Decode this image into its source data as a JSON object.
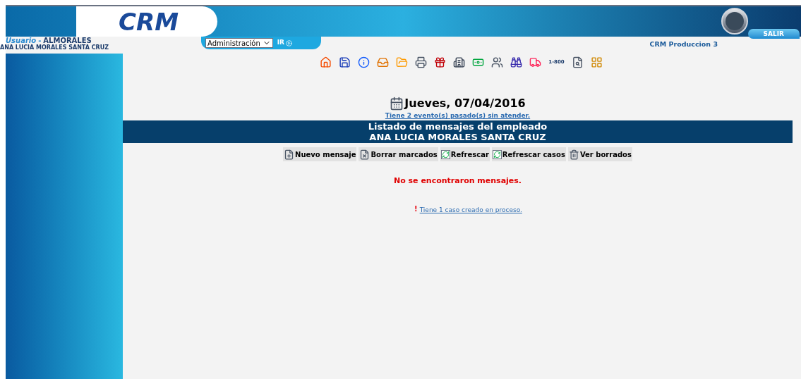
{
  "header": {
    "logo": "CRM",
    "exit_button": "SALIR"
  },
  "user": {
    "label": "Usuario",
    "separator": "-",
    "login": "ALMORALES",
    "full_name": "ANA LUCIA MORALES SANTA CRUZ"
  },
  "module_select": {
    "value": "Administración",
    "go_button": "IR"
  },
  "environment": "CRM Produccion 3",
  "toolbar_badge": "1-800",
  "date": "Jueves, 07/04/2016",
  "events_link": "Tiene 2 evento(s) pasado(s) sin atender.",
  "banner": {
    "title": "Listado de mensajes del empleado",
    "employee": "ANA LUCIA MORALES SANTA CRUZ"
  },
  "actions": [
    {
      "kind": "new",
      "label": "Nuevo mensaje"
    },
    {
      "kind": "delete",
      "label": "Borrar marcados"
    },
    {
      "kind": "refresh",
      "label": "Refrescar"
    },
    {
      "kind": "refresh",
      "label": "Refrescar casos"
    },
    {
      "kind": "trash",
      "label": "Ver borrados"
    }
  ],
  "empty_message": "No se encontraron mensajes.",
  "alert_mark": "!",
  "cases_link": "Tiene 1 caso creado en proceso."
}
